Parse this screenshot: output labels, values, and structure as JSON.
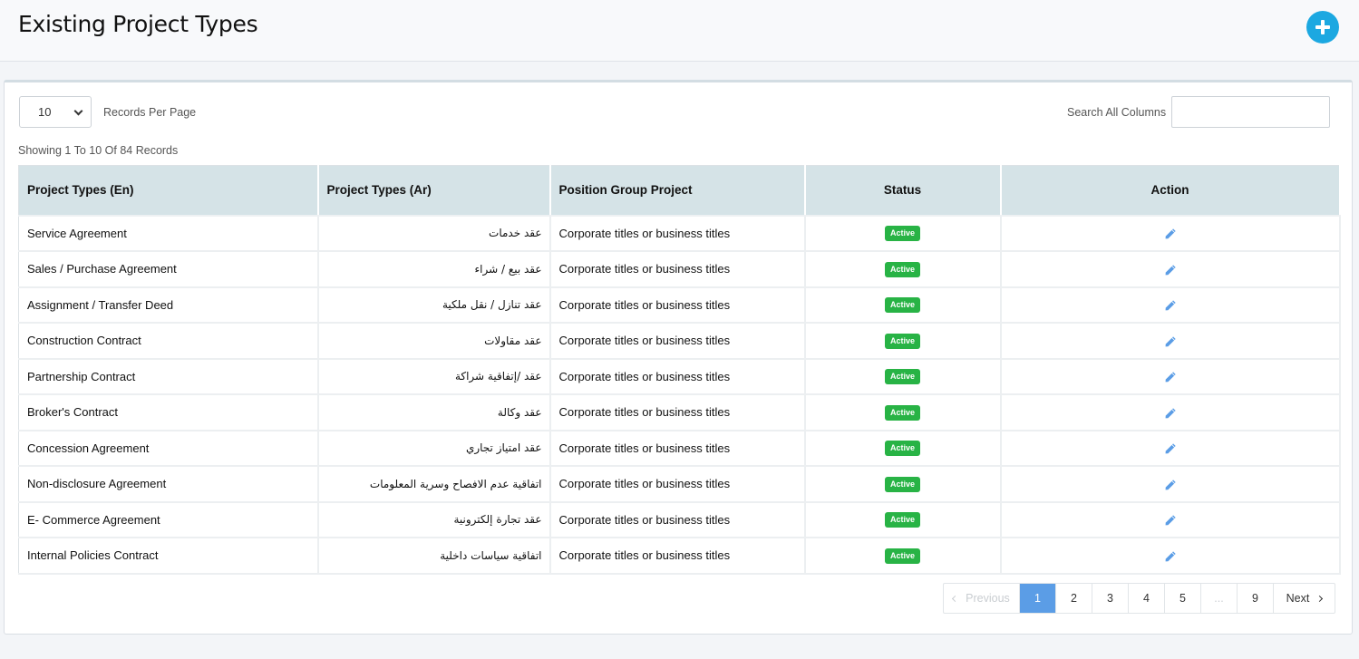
{
  "header": {
    "title": "Existing Project Types",
    "add_icon": "plus-circle-icon",
    "accent": "#1ca8e1"
  },
  "controls": {
    "per_page_value": "10",
    "per_page_label": "Records Per Page",
    "search_label": "Search All Columns",
    "search_value": "",
    "showing": "Showing 1 To 10 Of 84 Records"
  },
  "table": {
    "columns": [
      "Project Types (En)",
      "Project Types (Ar)",
      "Position Group Project",
      "Status",
      "Action"
    ],
    "rows": [
      {
        "en": "Service Agreement",
        "ar": "عقد خدمات",
        "group": "Corporate titles or business titles",
        "status": "Active"
      },
      {
        "en": "Sales / Purchase Agreement",
        "ar": "عقد بيع / شراء",
        "group": "Corporate titles or business titles",
        "status": "Active"
      },
      {
        "en": "Assignment / Transfer Deed",
        "ar": "عقد تنازل / نقل ملكية",
        "group": "Corporate titles or business titles",
        "status": "Active"
      },
      {
        "en": "Construction Contract",
        "ar": "عقد مقاولات",
        "group": "Corporate titles or business titles",
        "status": "Active"
      },
      {
        "en": "Partnership Contract",
        "ar": "عقد /إتفاقية شراكة",
        "group": "Corporate titles or business titles",
        "status": "Active"
      },
      {
        "en": "Broker's Contract",
        "ar": "عقد وكالة",
        "group": "Corporate titles or business titles",
        "status": "Active"
      },
      {
        "en": "Concession Agreement",
        "ar": "عقد امتياز تجاري",
        "group": "Corporate titles or business titles",
        "status": "Active"
      },
      {
        "en": "Non-disclosure Agreement",
        "ar": "اتفاقية عدم الافصاح وسرية المعلومات",
        "group": "Corporate titles or business titles",
        "status": "Active"
      },
      {
        "en": "E- Commerce Agreement",
        "ar": "عقد تجارة إلكترونية",
        "group": "Corporate titles or business titles",
        "status": "Active"
      },
      {
        "en": "Internal Policies Contract",
        "ar": "اتفاقية سياسات داخلية",
        "group": "Corporate titles or business titles",
        "status": "Active"
      }
    ],
    "action_icon": "pencil-icon",
    "status_color": "#28b345"
  },
  "pagination": {
    "previous": "Previous",
    "pages": [
      "1",
      "2",
      "3",
      "4",
      "5",
      "...",
      "9"
    ],
    "current": "1",
    "next": "Next"
  }
}
